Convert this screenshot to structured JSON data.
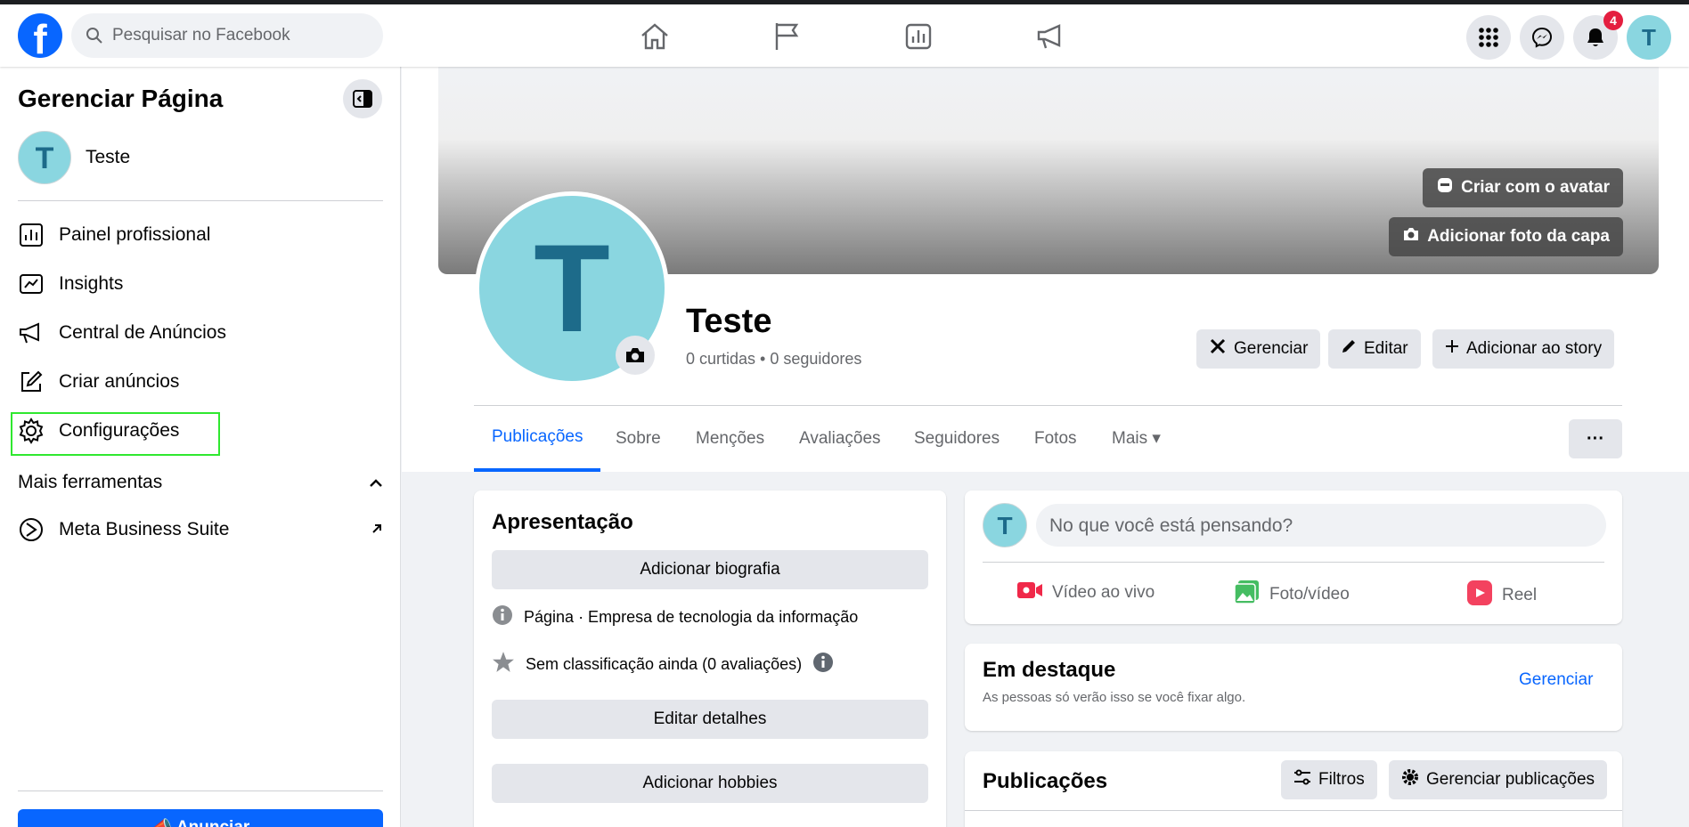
{
  "topbar": {
    "logo": "f",
    "search_placeholder": "Pesquisar no Facebook",
    "nav_icons": [
      "home-icon",
      "flag-icon",
      "insights-icon",
      "megaphone-icon"
    ],
    "right_icons": [
      "menu-grid-icon",
      "messenger-icon",
      "bell-icon"
    ],
    "notification_count": "4",
    "avatar_letter": "T"
  },
  "sidebar": {
    "title": "Gerenciar Página",
    "page_name": "Teste",
    "page_letter": "T",
    "items": [
      {
        "label": "Painel profissional",
        "icon": "dashboard-icon"
      },
      {
        "label": "Insights",
        "icon": "insights-icon"
      },
      {
        "label": "Central de Anúncios",
        "icon": "megaphone-icon"
      },
      {
        "label": "Criar anúncios",
        "icon": "edit-icon"
      },
      {
        "label": "Configurações",
        "icon": "gear-icon"
      }
    ],
    "section_label": "Mais ferramentas",
    "extra_item": "Meta Business Suite",
    "cta": "Anunciar"
  },
  "profile": {
    "avatar_letter": "T",
    "name": "Teste",
    "stats": "0 curtidas • 0 seguidores",
    "cover_buttons": [
      "Criar com o avatar",
      "Adicionar foto da capa"
    ],
    "actions": [
      "Gerenciar",
      "Editar",
      "Adicionar ao story"
    ]
  },
  "tabs": [
    {
      "label": "Publicações",
      "active": true
    },
    {
      "label": "Sobre"
    },
    {
      "label": "Menções"
    },
    {
      "label": "Avaliações"
    },
    {
      "label": "Seguidores"
    },
    {
      "label": "Fotos"
    },
    {
      "label": "Mais ▾"
    }
  ],
  "intro": {
    "title": "Apresentação",
    "add_bio": "Adicionar biografia",
    "category_bold": "Página",
    "category_rest": " · Empresa de tecnologia da informação",
    "rating": "Sem classificação ainda (0 avaliações)",
    "edit_details": "Editar detalhes",
    "add_hobbies": "Adicionar hobbies"
  },
  "composer": {
    "avatar_letter": "T",
    "placeholder": "No que você está pensando?",
    "actions": [
      "Vídeo ao vivo",
      "Foto/vídeo",
      "Reel"
    ]
  },
  "featured": {
    "title": "Em destaque",
    "subtitle": "As pessoas só verão isso se você fixar algo.",
    "manage": "Gerenciar"
  },
  "posts": {
    "title": "Publicações",
    "filters": "Filtros",
    "manage_posts": "Gerenciar publicações"
  },
  "colors": {
    "brand": "#0866ff",
    "avatar_bg": "#8ad6e0",
    "highlight": "#2fe82f"
  }
}
